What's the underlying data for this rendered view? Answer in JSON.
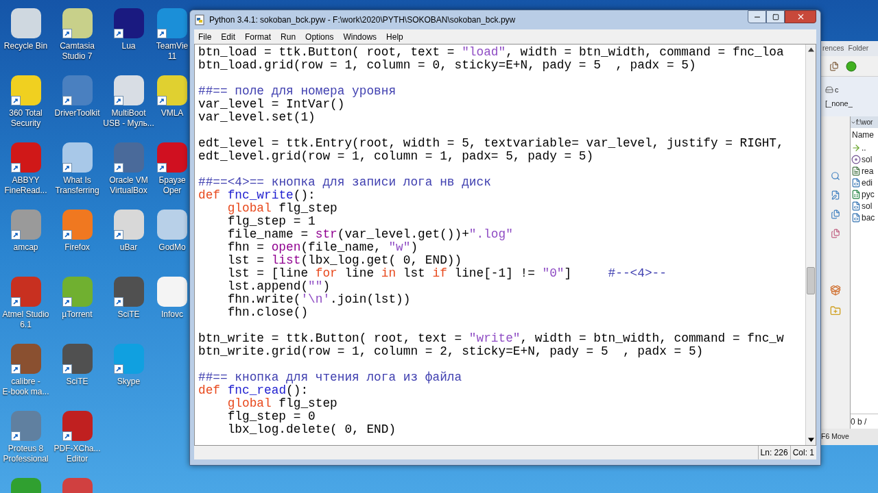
{
  "desktop": {
    "columns": [
      [
        {
          "lines": [
            "Recycle Bin"
          ],
          "color": "#cfd8e0",
          "shortcut": false
        },
        {
          "lines": [
            "360 Total",
            "Security"
          ],
          "color": "#f0d020",
          "shortcut": true
        },
        {
          "lines": [
            "ABBYY",
            "FineRead..."
          ],
          "color": "#d01818",
          "shortcut": true
        },
        {
          "lines": [
            "amcap"
          ],
          "color": "#9a9a9a",
          "shortcut": true
        },
        {
          "lines": [
            "Atmel Studio",
            "6.1"
          ],
          "color": "#c83020",
          "shortcut": true
        },
        {
          "lines": [
            "calibre -",
            "E-book ma..."
          ],
          "color": "#8a5030",
          "shortcut": true
        },
        {
          "lines": [
            "Proteus 8",
            "Professional"
          ],
          "color": "#6080a0",
          "shortcut": true
        },
        {
          "color": "#30a030"
        }
      ],
      [
        {
          "lines": [
            "Camtasia",
            "Studio 7"
          ],
          "color": "#c8d08a",
          "shortcut": true
        },
        {
          "lines": [
            "DriverToolkit"
          ],
          "color": "#4a80c0",
          "shortcut": true
        },
        {
          "lines": [
            "What Is",
            "Transferring"
          ],
          "color": "#a8c8e8",
          "shortcut": true
        },
        {
          "lines": [
            "Firefox"
          ],
          "color": "#f07820",
          "shortcut": true
        },
        {
          "lines": [
            "µTorrent"
          ],
          "color": "#70b030",
          "shortcut": true
        },
        {
          "lines": [
            "SciTE"
          ],
          "color": "#505050",
          "shortcut": true
        },
        {
          "lines": [
            "PDF-XCha...",
            "Editor"
          ],
          "color": "#c02020",
          "shortcut": true
        },
        {
          "color": "#d04040"
        }
      ],
      [
        {
          "lines": [
            "Lua"
          ],
          "color": "#1a1a80",
          "shortcut": true
        },
        {
          "lines": [
            "MultiBoot",
            "USB - Муль..."
          ],
          "color": "#d8dde4",
          "shortcut": true
        },
        {
          "lines": [
            "Oracle VM",
            "VirtualBox"
          ],
          "color": "#4a6a9a",
          "shortcut": true
        },
        {
          "lines": [
            "uBar"
          ],
          "color": "#d8d8d8",
          "shortcut": true
        },
        {
          "lines": [
            "SciTE"
          ],
          "color": "#505050",
          "shortcut": true
        },
        {
          "lines": [
            "Skype"
          ],
          "color": "#10a0e0",
          "shortcut": true
        }
      ],
      [
        {
          "lines": [
            "TeamVie",
            "11"
          ],
          "color": "#1b8fd8",
          "shortcut": true
        },
        {
          "lines": [
            "VMLA"
          ],
          "color": "#e0d030",
          "shortcut": true
        },
        {
          "lines": [
            "Браузе",
            "Oper"
          ],
          "color": "#d01020",
          "shortcut": true
        },
        {
          "lines": [
            "GodMo"
          ],
          "color": "#b8d0e8",
          "shortcut": false
        },
        {
          "lines": [
            "Infovc"
          ],
          "color": "#f4f4f4",
          "shortcut": false
        }
      ]
    ]
  },
  "editor": {
    "title": "Python 3.4.1: sokoban_bck.pyw - F:\\work\\2020\\PYTH\\SOKOBAN\\sokoban_bck.pyw",
    "menu": [
      "File",
      "Edit",
      "Format",
      "Run",
      "Options",
      "Windows",
      "Help"
    ],
    "lines": [
      {
        "kind": "code",
        "indented": false,
        "tokens": [
          {
            "text": "btn_load = ttk.Button( root, text = ",
            "kind": "plain"
          },
          {
            "text": "\"load\"",
            "kind": "string"
          },
          {
            "text": ", width = btn_width, command = fnc_loa",
            "kind": "plain"
          }
        ]
      },
      {
        "kind": "code",
        "indented": false,
        "tokens": [
          {
            "text": "btn_load.grid(row = 1, column = 0, sticky=E+N, pady = 5  , padx = 5)",
            "kind": "plain"
          }
        ]
      },
      {
        "kind": "blank"
      },
      {
        "kind": "code",
        "indented": false,
        "tokens": [
          {
            "text": "##== поле для номера уровня",
            "kind": "comment"
          }
        ]
      },
      {
        "kind": "code",
        "indented": false,
        "tokens": [
          {
            "text": "var_level = IntVar()",
            "kind": "plain"
          }
        ]
      },
      {
        "kind": "code",
        "indented": false,
        "tokens": [
          {
            "text": "var_level.set(1)",
            "kind": "plain"
          }
        ]
      },
      {
        "kind": "blank"
      },
      {
        "kind": "code",
        "indented": false,
        "tokens": [
          {
            "text": "edt_level = ttk.Entry(root, width = 5, textvariable= var_level, justify = RIGHT,",
            "kind": "plain"
          }
        ]
      },
      {
        "kind": "code",
        "indented": false,
        "tokens": [
          {
            "text": "edt_level.grid(row = 1, column = 1, padx= 5, pady = 5)",
            "kind": "plain"
          }
        ]
      },
      {
        "kind": "blank"
      },
      {
        "kind": "code",
        "indented": false,
        "tokens": [
          {
            "text": "##==<4>== кнопка для записи лога нв диск",
            "kind": "comment"
          }
        ]
      },
      {
        "kind": "code",
        "indented": false,
        "tokens": [
          {
            "text": "def",
            "kind": "keyword"
          },
          {
            "text": " fnc_write",
            "kind": "defname"
          },
          {
            "text": "():",
            "kind": "plain"
          }
        ]
      },
      {
        "kind": "code",
        "indented": true,
        "tokens": [
          {
            "text": "global",
            "kind": "keyword"
          },
          {
            "text": " flg_step",
            "kind": "plain"
          }
        ]
      },
      {
        "kind": "code",
        "indented": true,
        "tokens": [
          {
            "text": "flg_step = 1",
            "kind": "plain"
          }
        ]
      },
      {
        "kind": "code",
        "indented": true,
        "tokens": [
          {
            "text": "file_name = ",
            "kind": "plain"
          },
          {
            "text": "str",
            "kind": "builtin"
          },
          {
            "text": "(var_level.get())+",
            "kind": "plain"
          },
          {
            "text": "\".log\"",
            "kind": "string"
          }
        ]
      },
      {
        "kind": "code",
        "indented": true,
        "tokens": [
          {
            "text": "fhn = ",
            "kind": "plain"
          },
          {
            "text": "open",
            "kind": "builtin"
          },
          {
            "text": "(file_name, ",
            "kind": "plain"
          },
          {
            "text": "\"w\"",
            "kind": "string"
          },
          {
            "text": ")",
            "kind": "plain"
          }
        ]
      },
      {
        "kind": "code",
        "indented": true,
        "tokens": [
          {
            "text": "lst = ",
            "kind": "plain"
          },
          {
            "text": "list",
            "kind": "builtin"
          },
          {
            "text": "(lbx_log.get( 0, END))",
            "kind": "plain"
          }
        ]
      },
      {
        "kind": "code",
        "indented": true,
        "tokens": [
          {
            "text": "lst = [line ",
            "kind": "plain"
          },
          {
            "text": "for",
            "kind": "keyword"
          },
          {
            "text": " line ",
            "kind": "plain"
          },
          {
            "text": "in",
            "kind": "keyword"
          },
          {
            "text": " lst ",
            "kind": "plain"
          },
          {
            "text": "if",
            "kind": "keyword"
          },
          {
            "text": " line[-1] != ",
            "kind": "plain"
          },
          {
            "text": "\"0\"",
            "kind": "string"
          },
          {
            "text": "]     ",
            "kind": "plain"
          },
          {
            "text": "#--<4>--",
            "kind": "comment"
          }
        ]
      },
      {
        "kind": "code",
        "indented": true,
        "tokens": [
          {
            "text": "lst.append(",
            "kind": "plain"
          },
          {
            "text": "\"\"",
            "kind": "string"
          },
          {
            "text": ")",
            "kind": "plain"
          }
        ]
      },
      {
        "kind": "code",
        "indented": true,
        "tokens": [
          {
            "text": "fhn.write(",
            "kind": "plain"
          },
          {
            "text": "'\\n'",
            "kind": "string"
          },
          {
            "text": ".join(lst))",
            "kind": "plain"
          }
        ]
      },
      {
        "kind": "code",
        "indented": true,
        "tokens": [
          {
            "text": "fhn.close()",
            "kind": "plain"
          }
        ]
      },
      {
        "kind": "blank"
      },
      {
        "kind": "code",
        "indented": false,
        "tokens": [
          {
            "text": "btn_write = ttk.Button( root, text = ",
            "kind": "plain"
          },
          {
            "text": "\"write\"",
            "kind": "string"
          },
          {
            "text": ", width = btn_width, command = fnc_w",
            "kind": "plain"
          }
        ]
      },
      {
        "kind": "code",
        "indented": false,
        "tokens": [
          {
            "text": "btn_write.grid(row = 1, column = 2, sticky=E+N, pady = 5  , padx = 5)",
            "kind": "plain"
          }
        ]
      },
      {
        "kind": "blank"
      },
      {
        "kind": "code",
        "indented": false,
        "tokens": [
          {
            "text": "##== кнопка для чтения лога из файла",
            "kind": "comment"
          }
        ]
      },
      {
        "kind": "code",
        "indented": false,
        "tokens": [
          {
            "text": "def",
            "kind": "keyword"
          },
          {
            "text": " fnc_read",
            "kind": "defname"
          },
          {
            "text": "():",
            "kind": "plain"
          }
        ]
      },
      {
        "kind": "code",
        "indented": true,
        "tokens": [
          {
            "text": "global",
            "kind": "keyword"
          },
          {
            "text": " flg_step",
            "kind": "plain"
          }
        ]
      },
      {
        "kind": "code",
        "indented": true,
        "tokens": [
          {
            "text": "flg_step = 0",
            "kind": "plain"
          }
        ]
      },
      {
        "kind": "code",
        "indented": true,
        "tokens": [
          {
            "text": "lbx_log.delete( 0, END)",
            "kind": "plain"
          }
        ]
      }
    ],
    "status_bar": [
      "Ln: 226",
      "Col: 1"
    ]
  },
  "background_window": {
    "tabs": [
      "rences",
      "Folder"
    ],
    "drives": [
      "c",
      "[_none_"
    ],
    "path": "f:\\wor",
    "column": "Name",
    "files": [
      {
        "name": "..",
        "kind": "parent"
      },
      {
        "name": "sol",
        "kind": "disc"
      },
      {
        "name": "rea",
        "kind": "text"
      },
      {
        "name": "edi",
        "kind": "python"
      },
      {
        "name": "pyc",
        "kind": "spreadsheet"
      },
      {
        "name": "sol",
        "kind": "python"
      },
      {
        "name": "bac",
        "kind": "python"
      }
    ],
    "summary": "0 b /",
    "hint": "F6 Move"
  }
}
